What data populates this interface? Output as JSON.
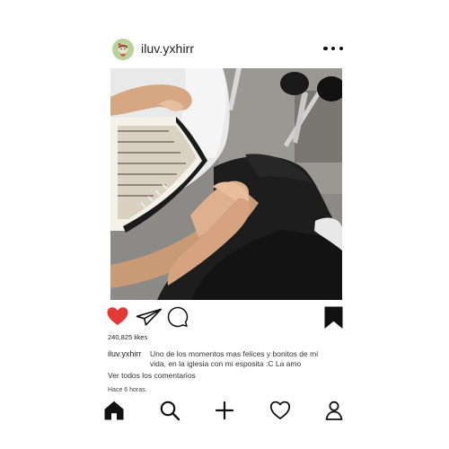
{
  "post": {
    "username": "iluv.yxhirr",
    "likes_text": "240,825 likes",
    "caption_username": "iluv.yxhirr",
    "caption_text": "Uno de los momentos mas felices y bonitos de mi vida, en la iglesia con mi esposita :C La amo",
    "view_comments": "Ver todos los comentarios",
    "time_ago": "Hace 6 horas."
  },
  "icons": {
    "more": "more-horizontal-icon",
    "like": "heart-filled-icon",
    "share": "paper-plane-icon",
    "comment": "speech-bubble-icon",
    "save": "bookmark-filled-icon",
    "home": "home-icon",
    "search": "search-icon",
    "add": "plus-icon",
    "activity": "heart-outline-icon",
    "profile": "profile-icon"
  },
  "colors": {
    "like_heart": "#e53935",
    "icon_black": "#111111",
    "background": "#ffffff"
  }
}
